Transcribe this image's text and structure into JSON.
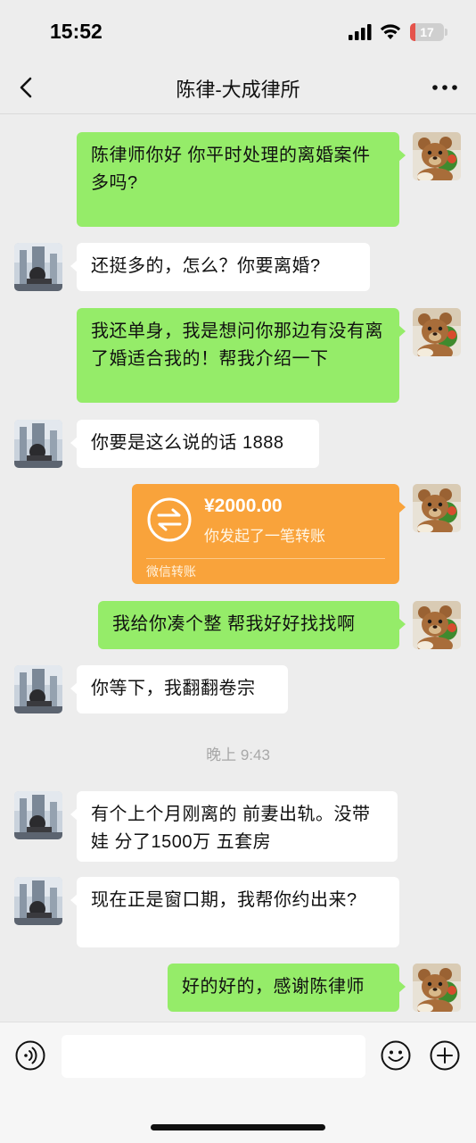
{
  "status_bar": {
    "time": "15:52",
    "battery_level": "17",
    "battery_fraction": 0.17
  },
  "header": {
    "title": "陈律-大成律所"
  },
  "messages": {
    "m1": {
      "sender": "me",
      "text": "陈律师你好 你平时处理的离婚案件多吗?"
    },
    "m2": {
      "sender": "other",
      "text": "还挺多的，怎么？你要离婚?"
    },
    "m3": {
      "sender": "me",
      "text": "我还单身，我是想问你那边有没有离了婚适合我的！帮我介绍一下"
    },
    "m4": {
      "sender": "other",
      "text": "你要是这么说的话 1888"
    },
    "m5": {
      "sender": "me",
      "type": "transfer",
      "amount": "¥2000.00",
      "description": "你发起了一笔转账",
      "footer": "微信转账"
    },
    "m6": {
      "sender": "me",
      "text": "我给你凑个整 帮我好好找找啊"
    },
    "m7": {
      "sender": "other",
      "text": "你等下，我翻翻卷宗"
    },
    "time_label": "晚上 9:43",
    "m8": {
      "sender": "other",
      "text": "有个上个月刚离的 前妻出轨。没带娃 分了1500万 五套房"
    },
    "m9": {
      "sender": "other",
      "text": "现在正是窗口期，我帮你约出来?"
    },
    "m10": {
      "sender": "me",
      "text": "好的好的，感谢陈律师"
    }
  },
  "input_bar": {
    "value": "",
    "placeholder": ""
  },
  "colors": {
    "my_bubble": "#95ec69",
    "other_bubble": "#ffffff",
    "transfer": "#f9a33b",
    "background": "#ededed"
  }
}
